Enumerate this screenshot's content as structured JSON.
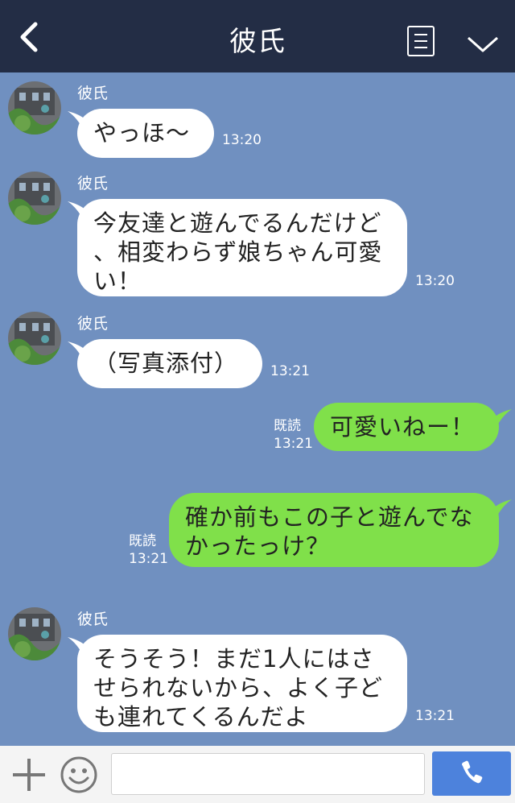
{
  "header": {
    "title": "彼氏"
  },
  "colors": {
    "header_bg": "#232d45",
    "chat_bg": "#7090c0",
    "sent_bubble": "#80e04a",
    "received_bubble": "#ffffff",
    "send_button": "#4d82dc"
  },
  "icons": {
    "back": "chevron-left-icon",
    "menu": "menu-icon",
    "collapse": "chevron-down-icon",
    "add": "plus-icon",
    "emoji": "smiley-icon",
    "call": "phone-icon"
  },
  "messages": [
    {
      "sender": "彼氏",
      "text": "やっほ〜",
      "time": "13:20"
    },
    {
      "sender": "彼氏",
      "lines": [
        "今友達と遊んでるんだけど",
        "、相変わらず娘ちゃん可愛",
        "い！"
      ],
      "time": "13:20"
    },
    {
      "sender": "彼氏",
      "text": "（写真添付）",
      "time": "13:21"
    },
    {
      "read": "既読",
      "text": "可愛いねー！",
      "time": "13:21"
    },
    {
      "read": "既読",
      "lines": [
        "確か前もこの子と遊んでな",
        "かったっけ？"
      ],
      "time": "13:21"
    },
    {
      "sender": "彼氏",
      "lines": [
        "そうそう！まだ1人にはさ",
        "せられないから、よく子ど",
        "も連れてくるんだよ"
      ],
      "time": "13:21"
    }
  ]
}
